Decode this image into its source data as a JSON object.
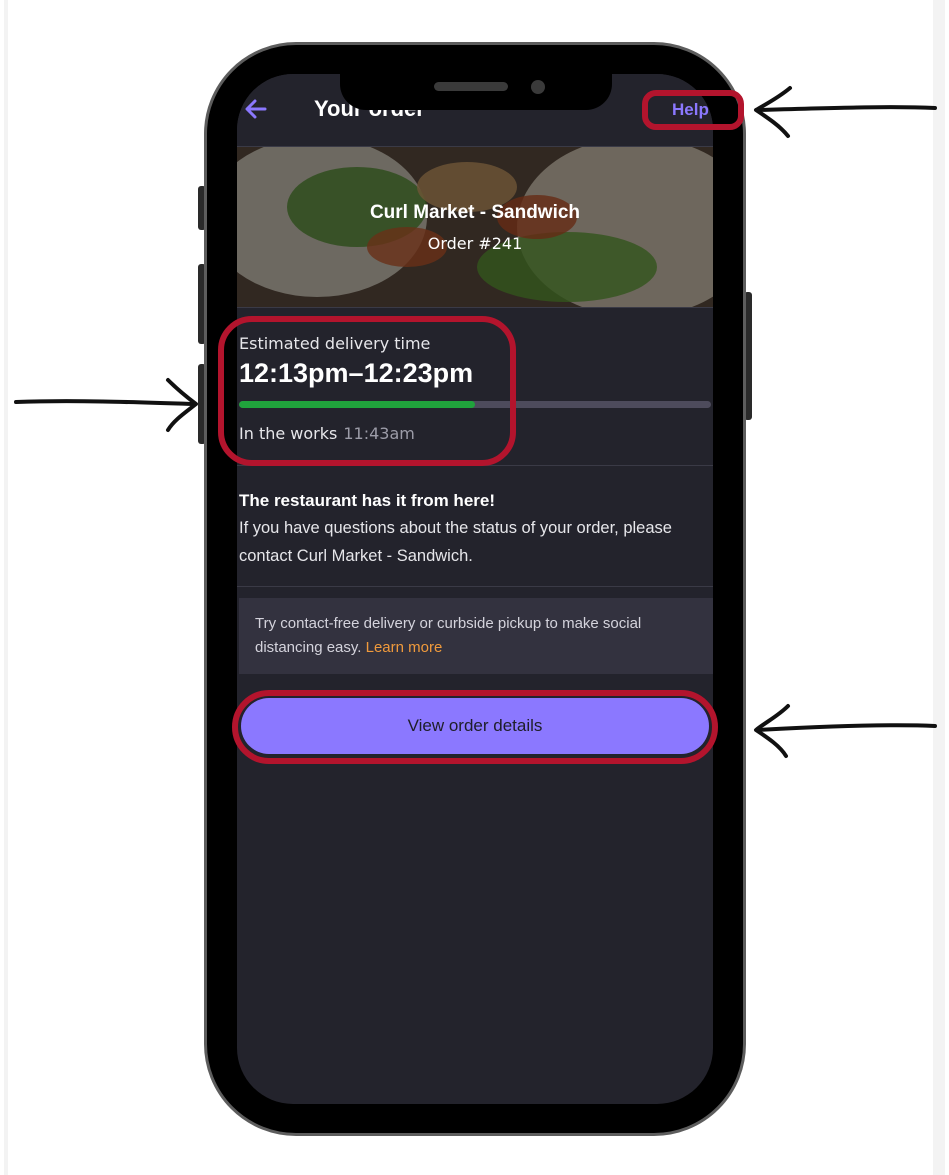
{
  "header": {
    "back_icon": "arrow-left-icon",
    "title": "Your order",
    "help_label": "Help"
  },
  "hero": {
    "store_name": "Curl Market - Sandwich",
    "order_number": "Order #241"
  },
  "delivery": {
    "label": "Estimated delivery time",
    "time_range": "12:13pm–12:23pm",
    "progress_percent": 50,
    "status": "In the works",
    "status_time": "11:43am"
  },
  "restaurant_note": {
    "heading": "The restaurant has it from here!",
    "body": "If you have questions about the status of your order, please contact Curl Market - Sandwich."
  },
  "tip": {
    "text": "Try contact-free delivery or curbside pickup to make social distancing easy.",
    "link": "Learn more"
  },
  "cta": {
    "label": "View order details"
  },
  "colors": {
    "accent": "#8b78ff",
    "progress": "#20a33c",
    "highlight": "#b3142d",
    "link": "#f09a3c"
  }
}
